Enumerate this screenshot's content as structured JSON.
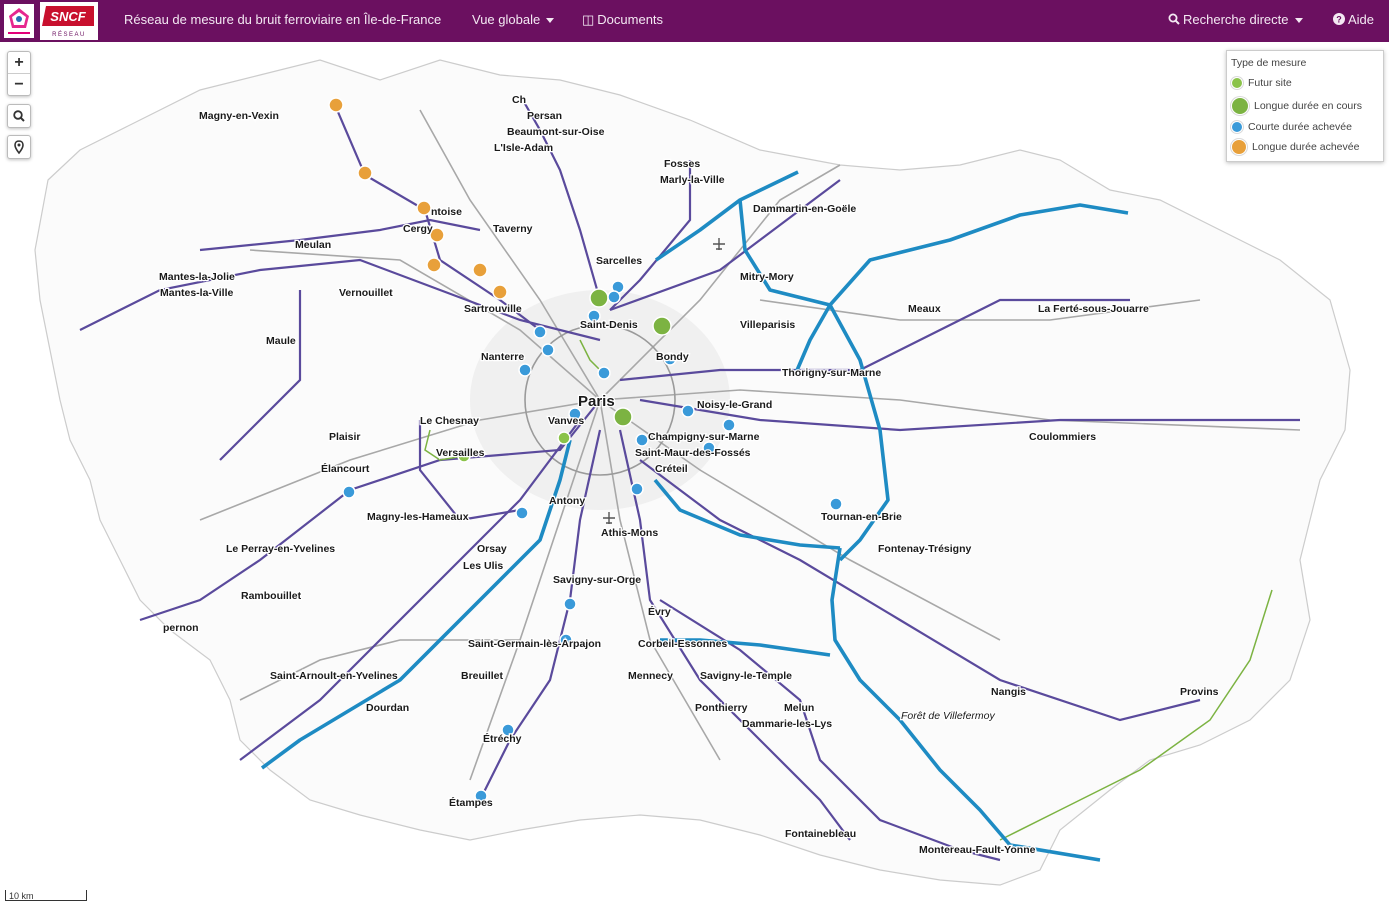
{
  "navbar": {
    "title": "Réseau de mesure du bruit ferroviaire en Île-de-France",
    "menu_overview": "Vue globale",
    "menu_documents": "Documents",
    "menu_search": "Recherche directe",
    "menu_help": "Aide",
    "brand_color": "#6b1060"
  },
  "logos": {
    "region": "Région Île-de-France",
    "sncf": "SNCF",
    "sncf_sub": "RÉSEAU"
  },
  "map_controls": {
    "zoom_in": "+",
    "zoom_out": "−",
    "search_icon": "search-icon",
    "locate_icon": "map-pin-icon"
  },
  "legend": {
    "title": "Type de mesure",
    "items": [
      {
        "label": "Futur site",
        "color": "#8bc34a",
        "size": "small"
      },
      {
        "label": "Longue durée en cours",
        "color": "#7cb342",
        "size": "large"
      },
      {
        "label": "Courte durée achevée",
        "color": "#3a9ad9",
        "size": "small"
      },
      {
        "label": "Longue durée achevée",
        "color": "#e8a03a",
        "size": "large"
      }
    ]
  },
  "scale": "10 km",
  "colors": {
    "lgv": "#1e8bc3",
    "rail": "#5a4a9c",
    "road": "#a8a8a8",
    "green_line": "#7cb342"
  },
  "places": {
    "paris": "Paris",
    "magny_en_vexin": "Magny-en-Vexin",
    "persan": "Persan",
    "ch": "Ch",
    "beaumont": "Beaumont-sur-Oise",
    "isle_adam": "L'Isle-Adam",
    "fosses": "Fosses",
    "marly_la_ville": "Marly-la-Ville",
    "dammartin": "Dammartin-en-Goële",
    "pontoise": "ntoise",
    "cergy": "Cergy",
    "taverny": "Taverny",
    "meulan": "Meulan",
    "mantes_la_jolie": "Mantes-la-Jolie",
    "mantes_la_ville": "Mantes-la-Ville",
    "vernouillet": "Vernouillet",
    "sarcelles": "Sarcelles",
    "mitry_mory": "Mitry-Mory",
    "meaux": "Meaux",
    "la_ferte": "La Ferté-sous-Jouarre",
    "sartrouville": "Sartrouville",
    "saint_denis": "Saint-Denis",
    "villeparisis": "Villeparisis",
    "maule": "Maule",
    "nanterre": "Nanterre",
    "bondy": "Bondy",
    "thorigny": "Thorigny-sur-Marne",
    "noisy": "Noisy-le-Grand",
    "le_chesnay": "Le Chesnay",
    "vanves": "Vanves",
    "plaisir": "Plaisir",
    "champigny": "Champigny-sur-Marne",
    "coulommiers": "Coulommiers",
    "versailles": "Versailles",
    "saint_maur": "Saint-Maur-des-Fossés",
    "elancourt": "Élancourt",
    "creteil": "Créteil",
    "antony": "Antony",
    "magny_hameaux": "Magny-les-Hameaux",
    "tournan": "Tournan-en-Brie",
    "athis_mons": "Athis-Mons",
    "le_perray": "Le Perray-en-Yvelines",
    "orsay": "Orsay",
    "fontenay_tresigny": "Fontenay-Trésigny",
    "les_ulis": "Les Ulis",
    "savigny": "Savigny-sur-Orge",
    "rambouillet": "Rambouillet",
    "evry": "Évry",
    "epernon": "pernon",
    "saint_germain_arpajon": "Saint-Germain-lès-Arpajon",
    "corbeil": "Corbeil-Essonnes",
    "saint_arnoult": "Saint-Arnoult-en-Yvelines",
    "breuillet": "Breuillet",
    "mennecy": "Mennecy",
    "savigny_temple": "Savigny-le-Temple",
    "nangis": "Nangis",
    "provins": "Provins",
    "dourdan": "Dourdan",
    "ponthierry": "Ponthierry",
    "melun": "Melun",
    "dammarie": "Dammarie-les-Lys",
    "foret_villefermoy": "Forêt de Villefermoy",
    "etrechy": "Étréchy",
    "etampes": "Étampes",
    "fontainebleau": "Fontainebleau",
    "montereau": "Montereau-Fault-Yonne"
  }
}
